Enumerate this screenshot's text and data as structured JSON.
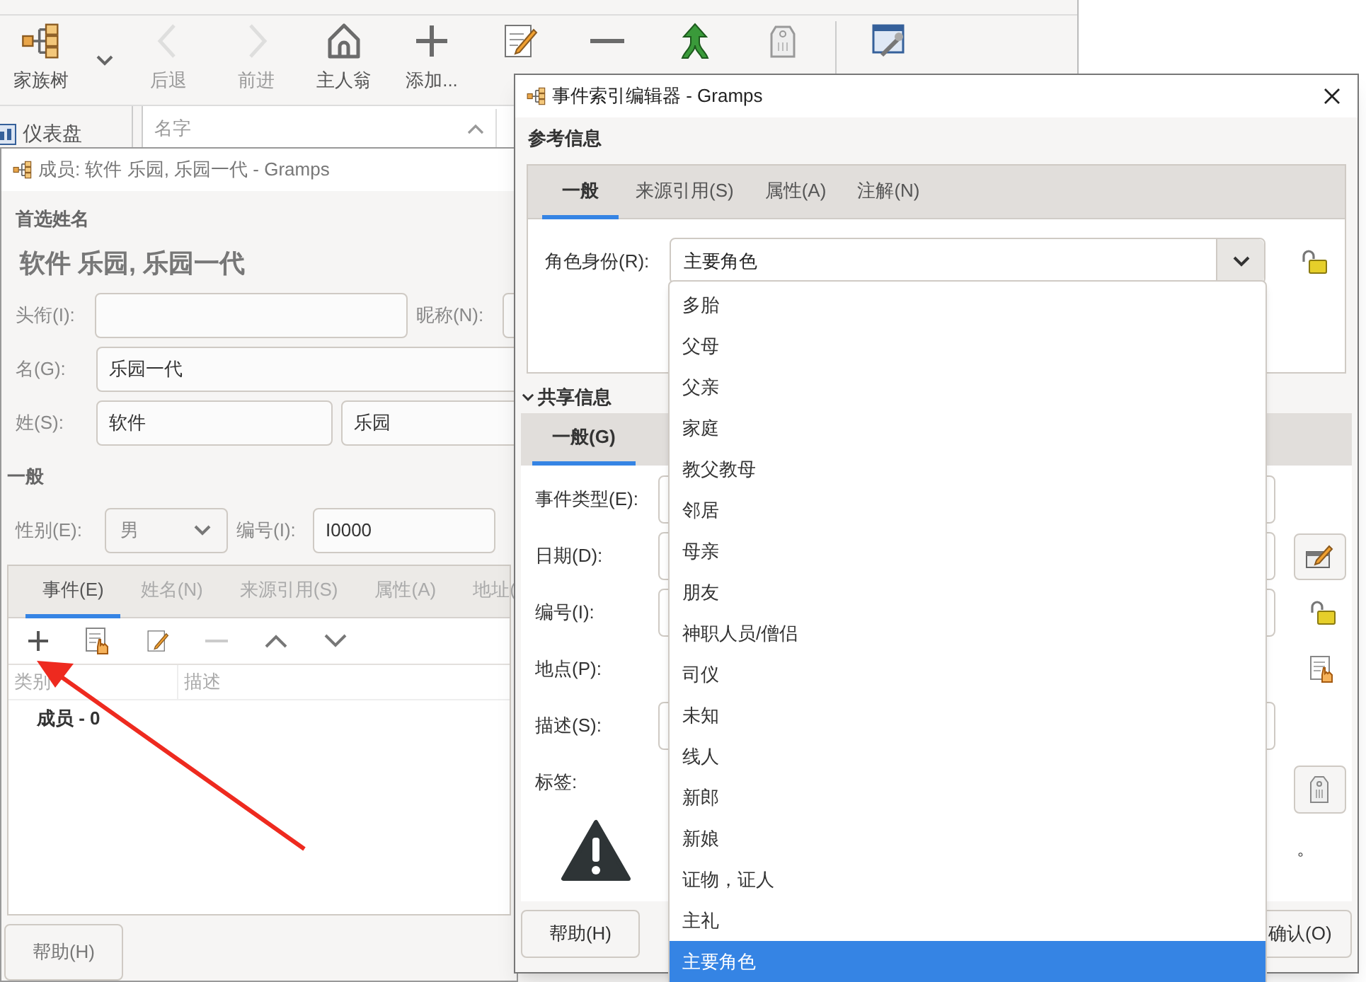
{
  "main_window": {
    "toolbar": [
      {
        "label": "家族树",
        "disabled": false
      },
      {
        "label": "后退",
        "disabled": true
      },
      {
        "label": "前进",
        "disabled": true
      },
      {
        "label": "主人翁",
        "disabled": false
      },
      {
        "label": "添加...",
        "disabled": false
      },
      {
        "disabled": false
      },
      {
        "disabled": false
      },
      {
        "disabled": false
      },
      {
        "disabled": false
      },
      {
        "disabled": false
      }
    ],
    "sidebar": {
      "items": [
        {
          "label": "仪表盘"
        }
      ]
    },
    "list": {
      "columns": [
        "名字"
      ]
    }
  },
  "person_editor": {
    "title": "成员: 软件 乐园, 乐园一代 - Gramps",
    "section": "首选姓名",
    "name_heading": "软件 乐园, 乐园一代",
    "title_field": {
      "label": "头衔(I):"
    },
    "nickname": {
      "label": "昵称(N):"
    },
    "given": {
      "label": "名(G):",
      "value": "乐园一代"
    },
    "surname": {
      "label": "姓(S):",
      "values": [
        "软件",
        "乐园"
      ]
    },
    "general_heading": "一般",
    "gender": {
      "label": "性别(E):",
      "value": "男"
    },
    "id": {
      "label": "编号(I):",
      "value": "I0000"
    },
    "tabs": [
      {
        "label": "事件(E)",
        "selected": true
      },
      {
        "label": "姓名(N)",
        "selected": false
      },
      {
        "label": "来源引用(S)",
        "selected": false
      },
      {
        "label": "属性(A)",
        "selected": false
      },
      {
        "label": "地址(",
        "selected": false
      }
    ],
    "table": {
      "columns": [
        "类别",
        "描述"
      ],
      "rows": [
        {
          "group": "成员 - 0"
        }
      ]
    },
    "buttons": [
      "帮助(H)"
    ]
  },
  "event_ref_editor": {
    "title": "事件索引编辑器 - Gramps",
    "reference_heading": "参考信息",
    "reference_tabs": [
      {
        "label": "一般",
        "selected": true
      },
      {
        "label": "来源引用(S)",
        "selected": false
      },
      {
        "label": "属性(A)",
        "selected": false
      },
      {
        "label": "注解(N)",
        "selected": false
      }
    ],
    "role": {
      "label": "角色身份(R):",
      "value": "主要角色"
    },
    "shared_heading": "共享信息",
    "shared_expanded": true,
    "shared_tabs": [
      {
        "label": "一般(G)",
        "selected": true
      }
    ],
    "fields": [
      {
        "label": "事件类型(E):",
        "kind": "entry"
      },
      {
        "label": "日期(D):",
        "kind": "entry"
      },
      {
        "label": "编号(I):",
        "kind": "entry"
      },
      {
        "label": "地点(P):",
        "kind": "plain"
      },
      {
        "label": "描述(S):",
        "kind": "entry"
      },
      {
        "label": "标签:",
        "kind": "plain"
      }
    ],
    "warning_text": "。",
    "buttons": [
      "帮助(H)",
      "确认(O)"
    ]
  },
  "role_dropdown": {
    "options": [
      {
        "label": "多胎",
        "selected": false
      },
      {
        "label": "父母",
        "selected": false
      },
      {
        "label": "父亲",
        "selected": false
      },
      {
        "label": "家庭",
        "selected": false
      },
      {
        "label": "教父教母",
        "selected": false
      },
      {
        "label": "邻居",
        "selected": false
      },
      {
        "label": "母亲",
        "selected": false
      },
      {
        "label": "朋友",
        "selected": false
      },
      {
        "label": "神职人员/僧侣",
        "selected": false
      },
      {
        "label": "司仪",
        "selected": false
      },
      {
        "label": "未知",
        "selected": false
      },
      {
        "label": "线人",
        "selected": false
      },
      {
        "label": "新郎",
        "selected": false
      },
      {
        "label": "新娘",
        "selected": false
      },
      {
        "label": "证物，证人",
        "selected": false
      },
      {
        "label": "主礼",
        "selected": false
      },
      {
        "label": "主要角色",
        "selected": true
      }
    ]
  }
}
